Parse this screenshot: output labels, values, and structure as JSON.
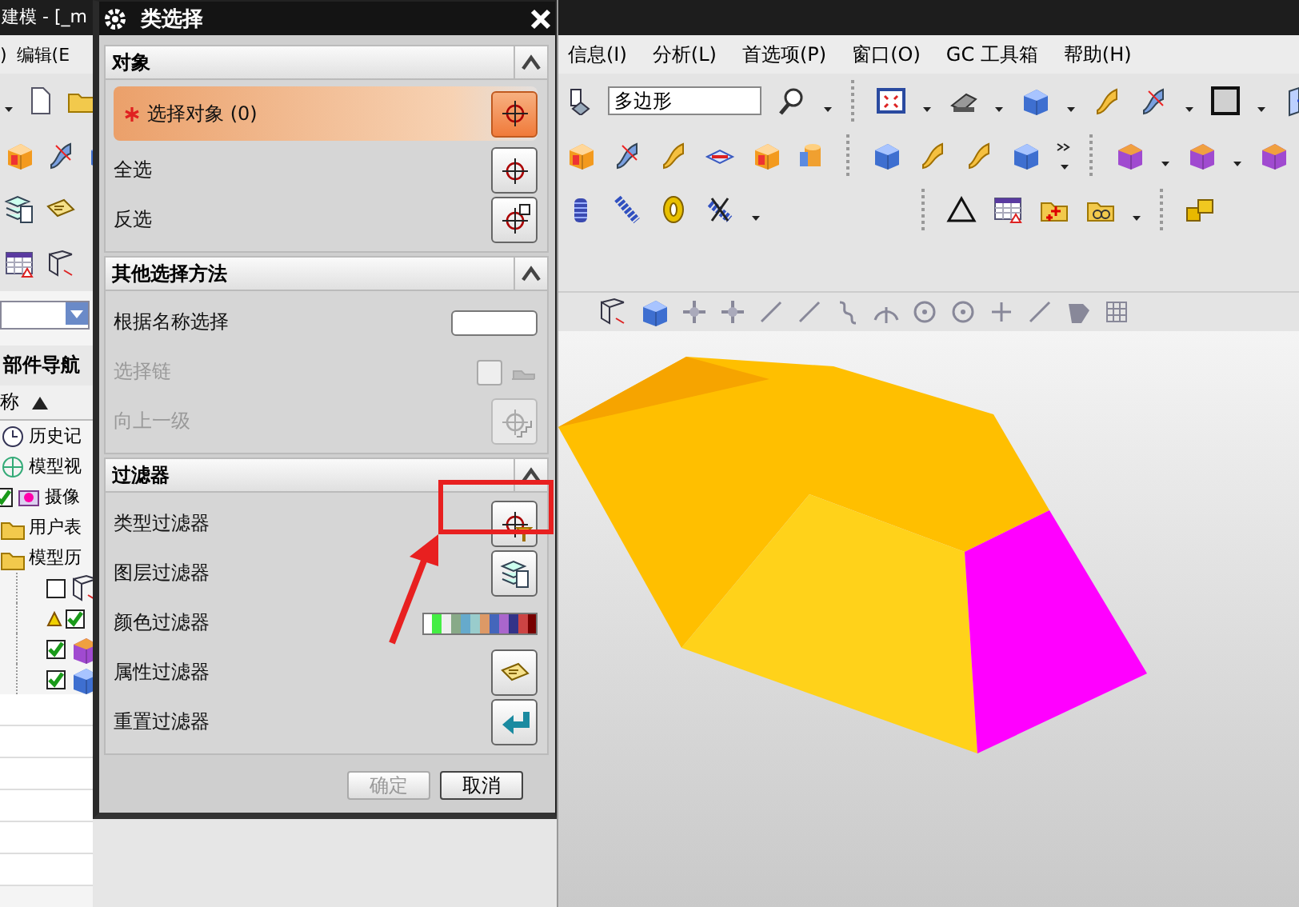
{
  "app": {
    "title": "建模 - [_m",
    "menu_left": [
      ")",
      "编辑(E"
    ],
    "menu": [
      "信息(I)",
      "分析(L)",
      "首选项(P)",
      "窗口(O)",
      "GC 工具箱",
      "帮助(H)"
    ],
    "search_field": {
      "value": "多边形"
    }
  },
  "part_navigator": {
    "title": "部件导航",
    "column": "称",
    "items": [
      {
        "label": "历史记",
        "kind": "history"
      },
      {
        "label": "模型视",
        "kind": "views"
      },
      {
        "label": "摄像",
        "kind": "camera",
        "checked": true
      },
      {
        "label": "用户表",
        "kind": "folder"
      },
      {
        "label": "模型历",
        "kind": "folder",
        "children": [
          {
            "checked": false,
            "warning": false
          },
          {
            "checked": true,
            "warning": true
          },
          {
            "checked": true,
            "warning": false
          },
          {
            "checked": true,
            "warning": false
          }
        ]
      }
    ]
  },
  "dialog": {
    "title": "类选择",
    "sections": [
      {
        "title": "对象",
        "expanded": true,
        "rows": [
          {
            "kind": "selection",
            "label": "选择对象 (0)",
            "required": true,
            "selected": true
          },
          {
            "kind": "button",
            "label": "全选",
            "disabled": false
          },
          {
            "kind": "button",
            "label": "反选",
            "disabled": false
          }
        ]
      },
      {
        "title": "其他选择方法",
        "expanded": true,
        "rows": [
          {
            "kind": "text_input",
            "label": "根据名称选择",
            "disabled": false
          },
          {
            "kind": "checkbox",
            "label": "选择链",
            "disabled": true,
            "checked": false
          },
          {
            "kind": "button",
            "label": "向上一级",
            "disabled": true
          }
        ]
      },
      {
        "title": "过滤器",
        "expanded": true,
        "rows": [
          {
            "kind": "button",
            "label": "类型过滤器",
            "disabled": false
          },
          {
            "kind": "button",
            "label": "图层过滤器",
            "disabled": false
          },
          {
            "kind": "color_strip",
            "label": "颜色过滤器",
            "disabled": false
          },
          {
            "kind": "button",
            "label": "属性过滤器",
            "disabled": false
          },
          {
            "kind": "button",
            "label": "重置过滤器",
            "disabled": false
          }
        ]
      }
    ],
    "buttons": [
      {
        "label": "确定",
        "disabled": true
      },
      {
        "label": "取消",
        "disabled": false
      }
    ]
  }
}
